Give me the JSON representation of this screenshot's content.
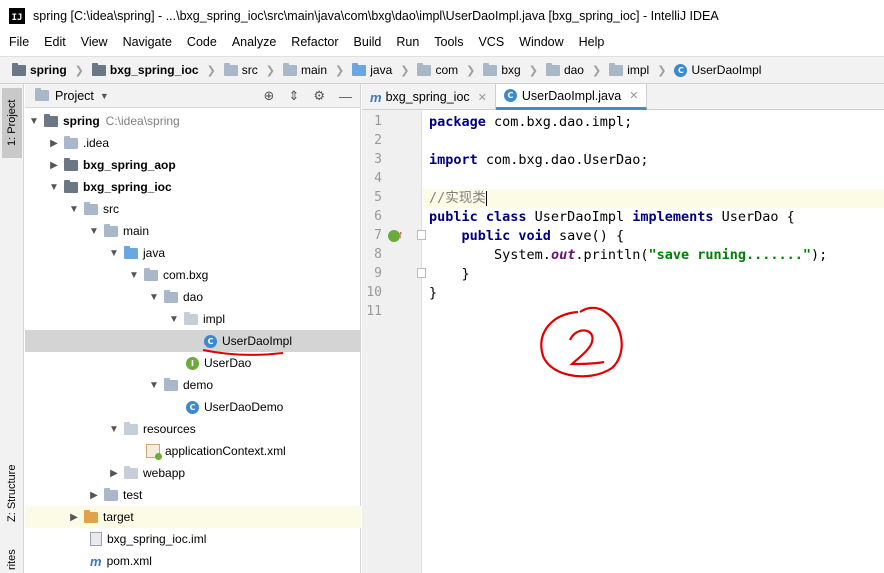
{
  "window": {
    "title": "spring [C:\\idea\\spring] - ...\\bxg_spring_ioc\\src\\main\\java\\com\\bxg\\dao\\impl\\UserDaoImpl.java [bxg_spring_ioc] - IntelliJ IDEA",
    "app_icon_text": "IJ"
  },
  "menu": [
    "File",
    "Edit",
    "View",
    "Navigate",
    "Code",
    "Analyze",
    "Refactor",
    "Build",
    "Run",
    "Tools",
    "VCS",
    "Window",
    "Help"
  ],
  "breadcrumb": [
    "spring",
    "bxg_spring_ioc",
    "src",
    "main",
    "java",
    "com",
    "bxg",
    "dao",
    "impl",
    "UserDaoImpl"
  ],
  "sidebar_tabs": {
    "project": "1: Project",
    "structure": "Z: Structure",
    "favorites": "rites"
  },
  "project_panel": {
    "title": "Project",
    "tree": [
      {
        "label": "spring",
        "path": "C:\\idea\\spring"
      },
      {
        "label": ".idea"
      },
      {
        "label": "bxg_spring_aop"
      },
      {
        "label": "bxg_spring_ioc"
      },
      {
        "label": "src"
      },
      {
        "label": "main"
      },
      {
        "label": "java"
      },
      {
        "label": "com.bxg"
      },
      {
        "label": "dao"
      },
      {
        "label": "impl"
      },
      {
        "label": "UserDaoImpl"
      },
      {
        "label": "UserDao"
      },
      {
        "label": "demo"
      },
      {
        "label": "UserDaoDemo"
      },
      {
        "label": "resources"
      },
      {
        "label": "applicationContext.xml"
      },
      {
        "label": "webapp"
      },
      {
        "label": "test"
      },
      {
        "label": "target"
      },
      {
        "label": "bxg_spring_ioc.iml"
      },
      {
        "label": "pom.xml"
      }
    ]
  },
  "editor_tabs": [
    {
      "label": "bxg_spring_ioc",
      "icon": "m"
    },
    {
      "label": "UserDaoImpl.java",
      "icon": "C"
    }
  ],
  "code": {
    "line_numbers": [
      "1",
      "2",
      "3",
      "4",
      "5",
      "6",
      "7",
      "8",
      "9",
      "10",
      "11"
    ],
    "l1": {
      "kw": "package",
      "rest": " com.bxg.dao.impl;"
    },
    "l3": {
      "kw": "import",
      "rest": " com.bxg.dao.UserDao;"
    },
    "l5": {
      "comment": "//实现类"
    },
    "l6": {
      "kw1": "public class",
      "name": " UserDaoImpl ",
      "kw2": "implements",
      "rest": " UserDao {"
    },
    "l7": {
      "indent": "    ",
      "kw": "public void",
      "rest": " save() {"
    },
    "l8": {
      "indent": "        ",
      "pre": "System.",
      "field": "out",
      "mid": ".println(",
      "str": "\"save runing.......\"",
      "post": ");"
    },
    "l9": "    }",
    "l10": "}"
  },
  "annotation": {
    "handwritten_text": "2",
    "color": "#e00000"
  }
}
